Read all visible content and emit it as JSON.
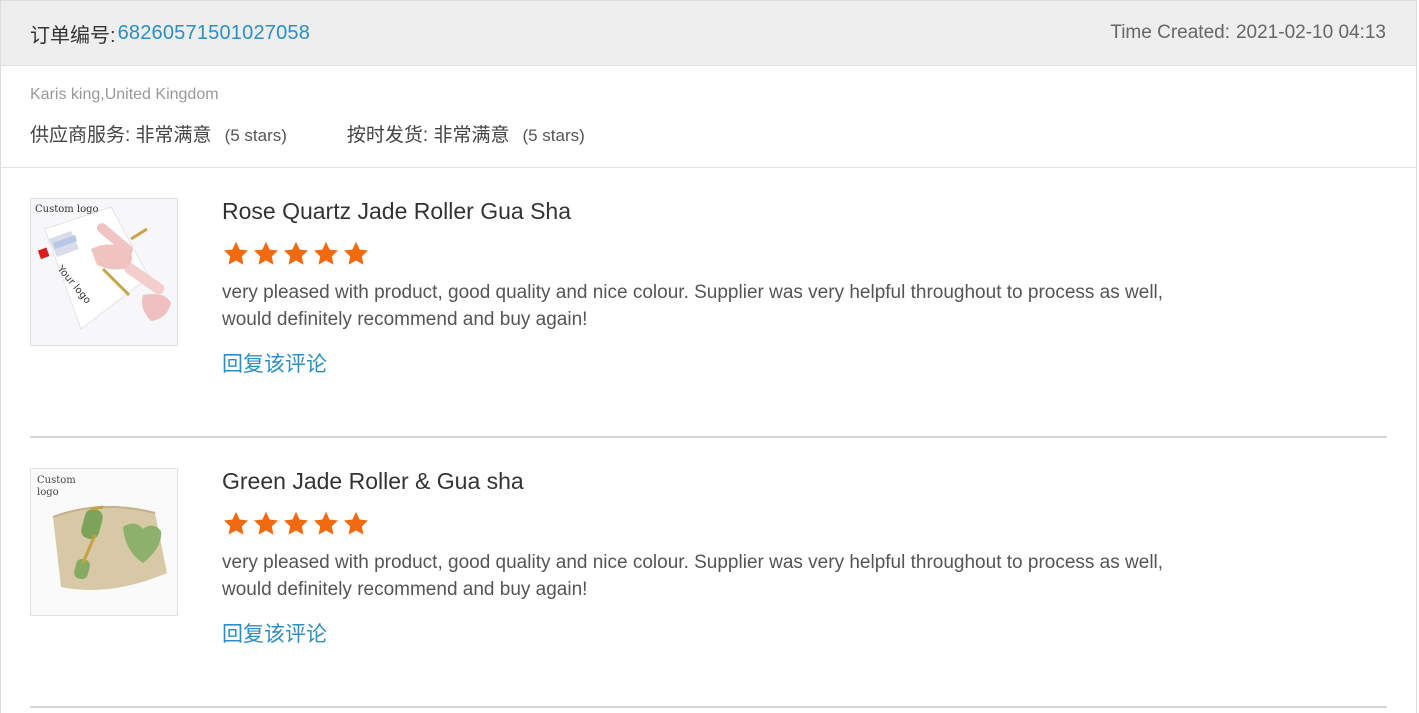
{
  "order": {
    "label": "订单编号:",
    "number": "68260571501027058",
    "time_label": "Time Created:",
    "time_value": "2021-02-10 04:13"
  },
  "buyer": {
    "name": "Karis king,United Kingdom"
  },
  "ratings": [
    {
      "label": "供应商服务: 非常满意",
      "stars_text": "(5 stars)"
    },
    {
      "label": "按时发货: 非常满意",
      "stars_text": "(5 stars)"
    }
  ],
  "reviews": [
    {
      "title": "Rose Quartz Jade Roller Gua Sha",
      "rating": 5,
      "comment": "very pleased with product, good quality and nice colour. Supplier was very helpful throughout to process as well, would definitely recommend and buy again!",
      "reply_label": "回复该评论",
      "thumb_text_1": "Custom logo",
      "thumb_text_2": "Your logo"
    },
    {
      "title": "Green Jade Roller & Gua sha",
      "rating": 5,
      "comment": "very pleased with product, good quality and nice colour. Supplier was very helpful throughout to process as well, would definitely recommend and buy again!",
      "reply_label": "回复该评论",
      "thumb_text_1": "Custom",
      "thumb_text_2": "logo"
    }
  ],
  "colors": {
    "link": "#2b8fc6",
    "star": "#f26a10",
    "header_bg": "#eeeeee"
  },
  "icons": {
    "star": "star-icon"
  }
}
